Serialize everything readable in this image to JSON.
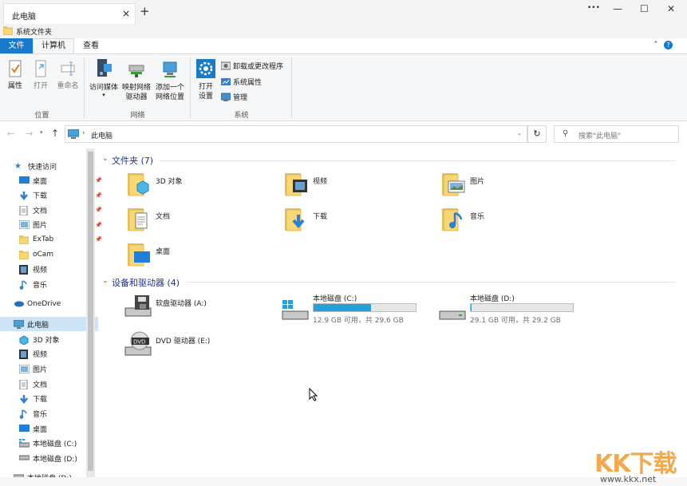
{
  "window": {
    "tab_title": "此电脑",
    "tab_close": "×",
    "new_tab": "+",
    "more": "•••",
    "minimize": "—",
    "maximize": "☐",
    "close": "✕"
  },
  "strip": {
    "label": "系统文件夹"
  },
  "ribbon_tabs": {
    "file": "文件",
    "computer": "计算机",
    "view": "查看",
    "help": "?"
  },
  "ribbon": {
    "location": {
      "properties": "属性",
      "open": "打开",
      "rename": "重命名",
      "group": "位置"
    },
    "network": {
      "media_line1": "访问媒体",
      "map_line1": "映射网络",
      "map_line2": "驱动器",
      "add_line1": "添加一个",
      "add_line2": "网络位置",
      "group": "网络"
    },
    "system": {
      "open_settings_line1": "打开",
      "open_settings_line2": "设置",
      "uninstall": "卸载或更改程序",
      "sys_props": "系统属性",
      "manage": "管理",
      "group": "系统"
    }
  },
  "address": {
    "path": "此电脑",
    "search_placeholder": "搜索\"此电脑\""
  },
  "sidebar": {
    "quick_access": "快速访问",
    "qa_items": [
      "桌面",
      "下载",
      "文档",
      "图片",
      "ExTab",
      "oCam",
      "视频",
      "音乐"
    ],
    "onedrive": "OneDrive",
    "this_pc": "此电脑",
    "pc_items": [
      "3D 对象",
      "视频",
      "图片",
      "文档",
      "下载",
      "音乐",
      "桌面",
      "本地磁盘 (C:)",
      "本地磁盘 (D:)"
    ],
    "cut_item": "本地磁盘 (D:)"
  },
  "content": {
    "folders_header": "文件夹 (7)",
    "folders": [
      "3D 对象",
      "视频",
      "图片",
      "文档",
      "下载",
      "音乐",
      "桌面"
    ],
    "devices_header": "设备和驱动器 (4)",
    "floppy": "软盘驱动器 (A:)",
    "drive_c": {
      "name": "本地磁盘 (C:)",
      "free": "12.9 GB 可用，共 29.6 GB",
      "used_fraction": 0.564
    },
    "drive_d": {
      "name": "本地磁盘 (D:)",
      "free": "29.1 GB 可用，共 29.2 GB",
      "used_fraction": 0.003
    },
    "dvd": "DVD 驱动器 (E:)"
  },
  "watermark": {
    "text": "KK下载",
    "url": "www.kkx.net"
  },
  "colors": {
    "accent": "#1979ca",
    "drive_fill": "#26a0da",
    "folder": "#f8d775",
    "section": "#1e3287"
  }
}
